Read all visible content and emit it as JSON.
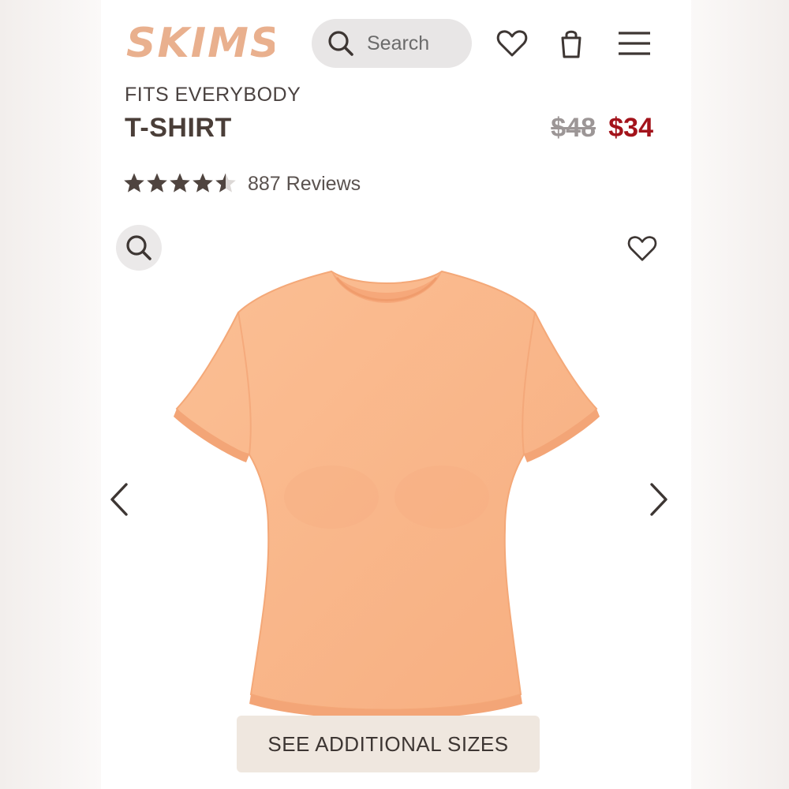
{
  "brand": {
    "logo_text": "SKIMS",
    "color": "#e9b08e"
  },
  "header": {
    "search": {
      "placeholder": "Search",
      "icon": "search-icon"
    },
    "icons": [
      "heart-icon",
      "shopping-bag-icon",
      "menu-icon"
    ]
  },
  "product": {
    "collection": "FITS EVERYBODY",
    "name": "T-SHIRT",
    "original_price": "$48",
    "sale_price": "$34",
    "rating": 4.5,
    "rating_max": 5,
    "reviews_label": "887 Reviews",
    "image_color": "#f9b88c"
  },
  "gallery": {
    "zoom_icon": "zoom-icon",
    "favorite_icon": "heart-icon",
    "prev_icon": "chevron-left-icon",
    "next_icon": "chevron-right-icon"
  },
  "actions": {
    "sizes_label": "SEE ADDITIONAL SIZES"
  },
  "colors": {
    "sale_red": "#a3131b",
    "text_dark": "#4a3e38",
    "button_bg": "#efe7df"
  }
}
